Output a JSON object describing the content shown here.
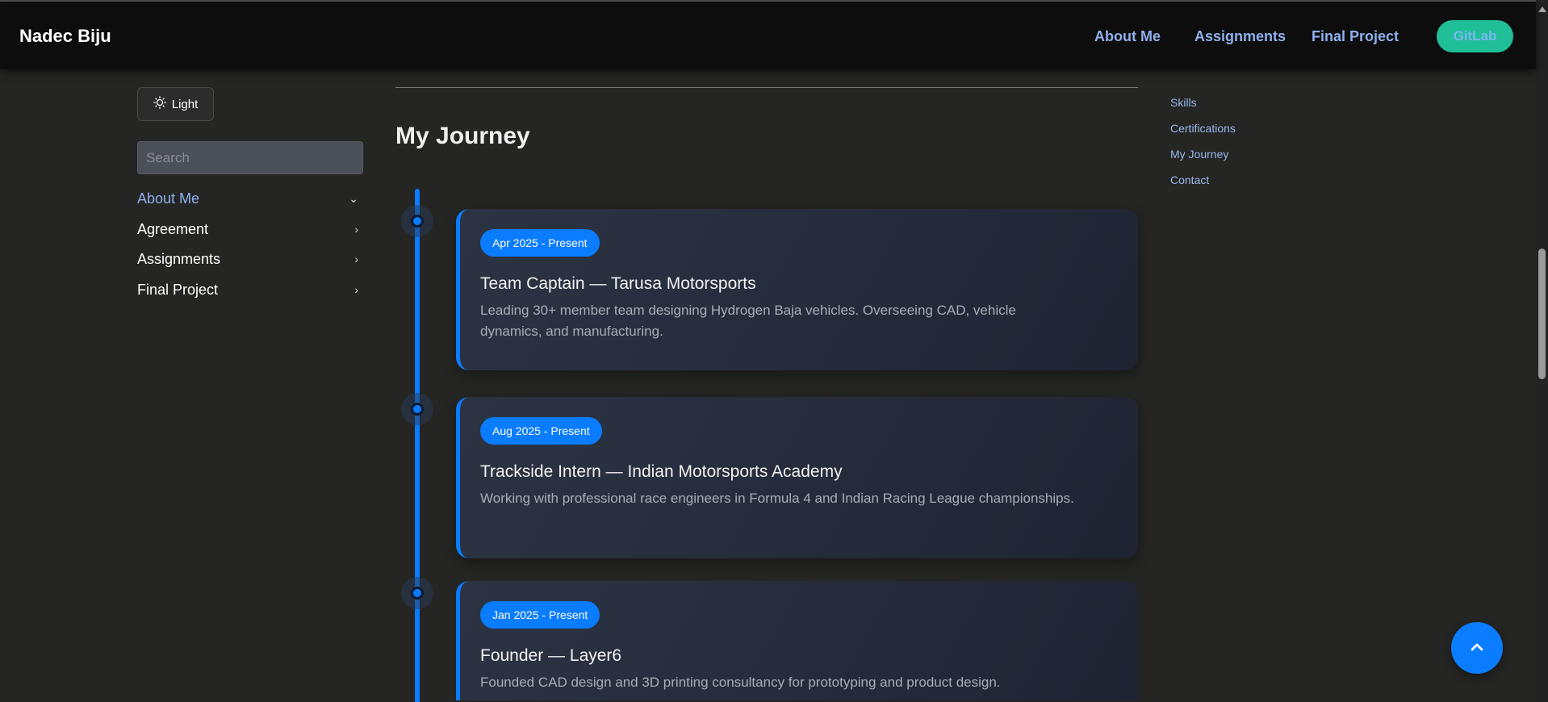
{
  "nav": {
    "brand": "Nadec Biju",
    "links": [
      "About Me",
      "Assignments",
      "Final Project"
    ],
    "gitlab_label": "GitLab"
  },
  "sidebar": {
    "theme_toggle_label": "Light",
    "search_placeholder": "Search",
    "items": [
      {
        "label": "About Me",
        "expanded": true
      },
      {
        "label": "Agreement"
      },
      {
        "label": "Assignments"
      },
      {
        "label": "Final Project"
      }
    ]
  },
  "main": {
    "section_title": "My Journey",
    "timeline": [
      {
        "date": "Apr 2025 - Present",
        "title": "Team Captain — Tarusa Motorsports",
        "description": "Leading 30+ member team designing Hydrogen Baja vehicles. Overseeing CAD, vehicle dynamics, and manufacturing."
      },
      {
        "date": "Aug 2025 - Present",
        "title": "Trackside Intern — Indian Motorsports Academy",
        "description": "Working with professional race engineers in Formula 4 and Indian Racing League championships."
      },
      {
        "date": "Jan 2025 - Present",
        "title": "Founder — Layer6",
        "description": "Founded CAD design and 3D printing consultancy for prototyping and product design."
      }
    ]
  },
  "toc": [
    "Skills",
    "Certifications",
    "My Journey",
    "Contact"
  ],
  "colors": {
    "accent": "#0a7cff",
    "gitlab": "#20bf98",
    "link": "#8fb0ee"
  }
}
